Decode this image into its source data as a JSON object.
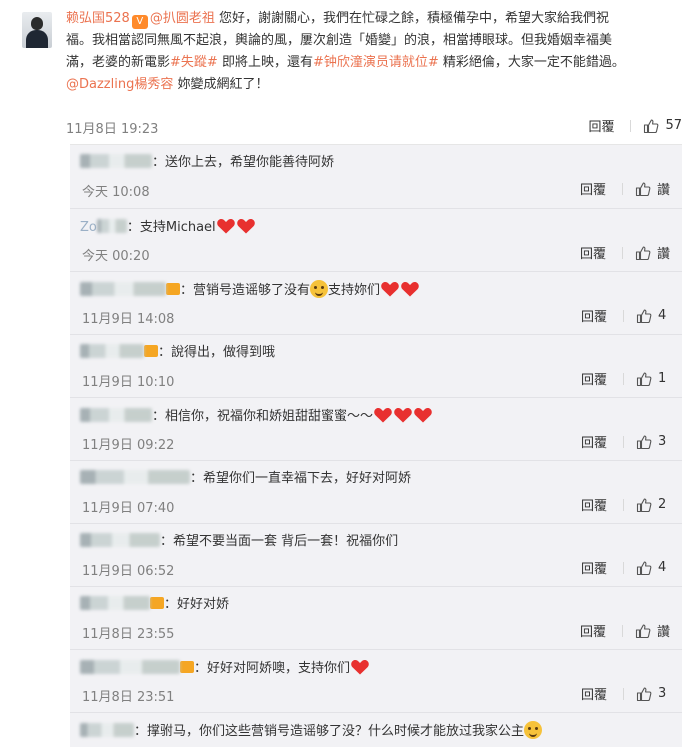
{
  "main_comment": {
    "username": "赖弘国528",
    "reply_to": "@扒圆老祖",
    "text_1": " 您好，謝謝關心，我們在忙碌之餘，積極備孕中，希望大家給我們祝",
    "text_2": "福。我相當認同無風不起浪，輿論的風，屢次創造「婚變」的浪，相當搏眼球。但我婚姻幸福美",
    "text_3": "滿，老婆的新電影",
    "tag_1": "#失蹤#",
    "text_4": " 即將上映，還有",
    "tag_2": "#钟欣潼演员请就位#",
    "text_5": " 精彩絕倫，大家一定不能錯過。",
    "mention": "@Dazzling楊秀容",
    "text_6": " 妳變成網紅了！",
    "time": "11月8日 19:23",
    "reply_label": "回覆",
    "likes": "57"
  },
  "replies": [
    {
      "text": "：送你上去，希望你能善待阿娇",
      "time": "今天 10:08",
      "reply_label": "回覆",
      "likes": "讚"
    },
    {
      "name_visible": "Zo",
      "text": "：支持Michael",
      "time": "今天 00:20",
      "reply_label": "回覆",
      "likes": "讚"
    },
    {
      "text_a": "：营销号造谣够了没有",
      "text_b": "支持妳们",
      "time": "11月9日 14:08",
      "reply_label": "回覆",
      "likes": "4"
    },
    {
      "text": "：說得出，做得到哦",
      "time": "11月9日 10:10",
      "reply_label": "回覆",
      "likes": "1"
    },
    {
      "text": "：相信你，祝福你和娇姐甜甜蜜蜜～～",
      "time": "11月9日 09:22",
      "reply_label": "回覆",
      "likes": "3"
    },
    {
      "text": "：希望你们一直幸福下去，好好对阿娇",
      "time": "11月9日 07:40",
      "reply_label": "回覆",
      "likes": "2"
    },
    {
      "text": "：希望不要当面一套 背后一套！祝福你们",
      "time": "11月9日 06:52",
      "reply_label": "回覆",
      "likes": "4"
    },
    {
      "text": "：好好对娇",
      "time": "11月8日 23:55",
      "reply_label": "回覆",
      "likes": "讚"
    },
    {
      "text": "：好好对阿娇噢，支持你们",
      "time": "11月8日 23:51",
      "reply_label": "回覆",
      "likes": "3"
    },
    {
      "text": "：撑驸马，你们这些营销号造谣够了没？什么时候才能放过我家公主"
    }
  ],
  "colors": {
    "link": "#eb7350",
    "muted": "#808080",
    "heart": "#e8302f",
    "panel_bg": "#f2f2f5"
  }
}
